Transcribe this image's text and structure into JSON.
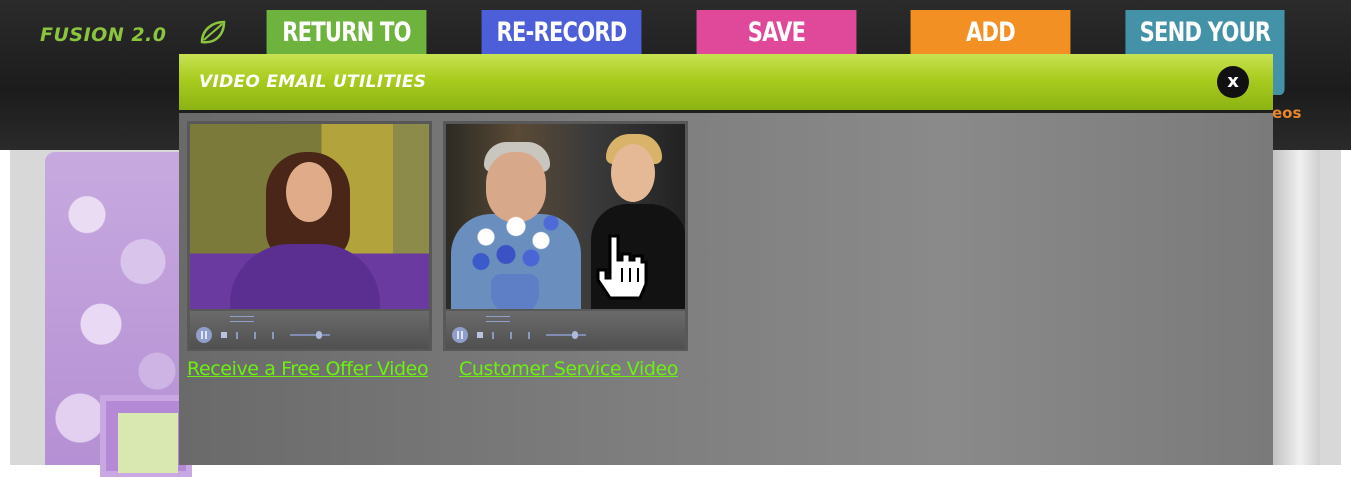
{
  "header": {
    "logo_text": "FUSION 2.0",
    "nav": [
      {
        "label": "RETURN TO",
        "color": "#6fb33f"
      },
      {
        "label": "RE-RECORD",
        "color": "#4c5fd8"
      },
      {
        "label": "SAVE",
        "color": "#e0489a"
      },
      {
        "label": "ADD",
        "color": "#f39023"
      },
      {
        "label": "SEND YOUR",
        "color": "#4392a8"
      }
    ],
    "partial_text": "eos"
  },
  "modal": {
    "title": "VIDEO EMAIL UTILITIES",
    "close_label": "x",
    "accent_color": "#a9cc1f",
    "videos": [
      {
        "link_text": "Receive a Free Offer Video"
      },
      {
        "link_text": "Customer Service Video"
      }
    ]
  },
  "icons": {
    "logo": "leaf-logo-icon",
    "close": "close-icon",
    "cursor": "hand-pointer-icon",
    "play": "pause-icon",
    "stop": "stop-icon"
  },
  "colors": {
    "link": "#6cf00f",
    "modal_bg": "#7b7b7b"
  }
}
